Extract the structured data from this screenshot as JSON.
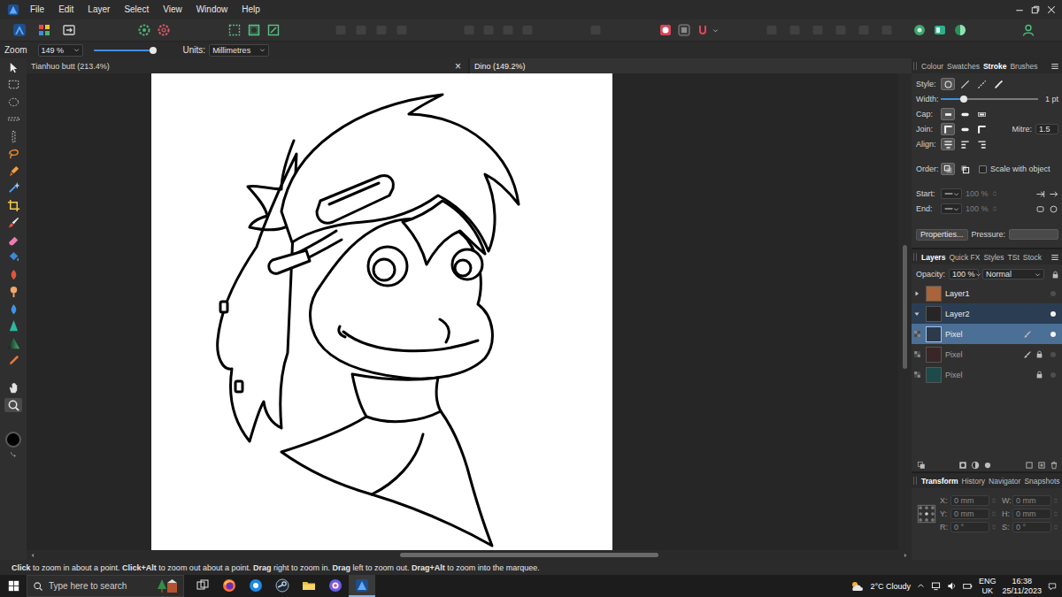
{
  "menu": [
    "File",
    "Edit",
    "Layer",
    "Select",
    "View",
    "Window",
    "Help"
  ],
  "toolbar": [
    [
      {
        "kind": "persona-photo",
        "disabled": false
      },
      {
        "kind": "persona-liquify",
        "disabled": false
      },
      {
        "kind": "persona-export",
        "disabled": false
      }
    ],
    [
      {
        "kind": "settings",
        "disabled": false
      },
      {
        "kind": "settings-alt",
        "disabled": false
      }
    ],
    [
      {
        "kind": "selection-all",
        "disabled": false
      },
      {
        "kind": "selection-invert",
        "disabled": false
      },
      {
        "kind": "selection-refine",
        "disabled": false
      }
    ],
    [
      {
        "kind": "generic",
        "disabled": true
      },
      {
        "kind": "generic",
        "disabled": true
      },
      {
        "kind": "generic",
        "disabled": true
      },
      {
        "kind": "generic",
        "disabled": true
      }
    ],
    [
      {
        "kind": "generic",
        "disabled": true
      },
      {
        "kind": "generic",
        "disabled": true
      },
      {
        "kind": "generic",
        "disabled": true
      },
      {
        "kind": "generic",
        "disabled": true
      }
    ],
    [
      {
        "kind": "generic",
        "disabled": true
      }
    ],
    [
      {
        "kind": "mask",
        "disabled": false
      },
      {
        "kind": "quick-mask",
        "disabled": false
      },
      {
        "kind": "snapping",
        "disabled": false
      }
    ],
    [
      {
        "kind": "generic",
        "disabled": true
      },
      {
        "kind": "generic",
        "disabled": true
      },
      {
        "kind": "generic",
        "disabled": true
      },
      {
        "kind": "generic",
        "disabled": true
      },
      {
        "kind": "generic",
        "disabled": true
      },
      {
        "kind": "generic",
        "disabled": true
      }
    ],
    [
      {
        "kind": "assistant",
        "disabled": false
      },
      {
        "kind": "studio",
        "disabled": false
      },
      {
        "kind": "mode",
        "disabled": false
      }
    ],
    [
      {
        "kind": "account",
        "disabled": false
      }
    ]
  ],
  "context_bar": {
    "zoom_label": "Zoom",
    "zoom_value": "149 %",
    "zoom_level": 0.97,
    "units_label": "Units:",
    "units_value": "Millimetres"
  },
  "document_tabs": [
    {
      "label": "Tianhuo butt (213.4%)",
      "selected": false,
      "show_close": true
    },
    {
      "label": "Dino (149.2%)",
      "selected": true,
      "show_close": false
    }
  ],
  "close_glyph": "×",
  "tools": [
    [
      {
        "kind": "move",
        "selected": false
      },
      {
        "kind": "rect-marquee",
        "selected": false
      },
      {
        "kind": "ellipse-marquee",
        "selected": false
      },
      {
        "kind": "row-marquee",
        "selected": false
      },
      {
        "kind": "column-marquee",
        "selected": false
      },
      {
        "kind": "freehand-selection",
        "selected": false
      },
      {
        "kind": "selection-brush",
        "selected": false
      },
      {
        "kind": "flood-select",
        "selected": false
      },
      {
        "kind": "crop",
        "selected": false
      },
      {
        "kind": "paint-brush",
        "selected": false
      },
      {
        "kind": "erase-brush",
        "selected": false
      },
      {
        "kind": "flood-fill",
        "selected": false
      },
      {
        "kind": "burn",
        "selected": false
      },
      {
        "kind": "dodge",
        "selected": false
      },
      {
        "kind": "blur",
        "selected": false
      },
      {
        "kind": "sharpen",
        "selected": false
      },
      {
        "kind": "gradient",
        "selected": false
      },
      {
        "kind": "colour-picker",
        "selected": false
      }
    ],
    [
      {
        "kind": "hand",
        "selected": false
      },
      {
        "kind": "zoom",
        "selected": true
      }
    ]
  ],
  "canvas": {
    "vscroll": {
      "start": 0.36,
      "size": 0.26
    },
    "hscroll": {
      "start": 0.42,
      "size": 0.3
    }
  },
  "stroke_panel": {
    "tabs": [
      {
        "label": "Colour",
        "selected": false
      },
      {
        "label": "Swatches",
        "selected": false
      },
      {
        "label": "Stroke",
        "selected": true
      },
      {
        "label": "Brushes",
        "selected": false
      }
    ],
    "style_label": "Style:",
    "styles": [
      {
        "kind": "none",
        "selected": true
      },
      {
        "kind": "solid",
        "selected": false
      },
      {
        "kind": "dashed",
        "selected": false
      },
      {
        "kind": "brush",
        "selected": false
      }
    ],
    "width_label": "Width:",
    "width_level": 0.24,
    "width_value": "1 pt",
    "cap_label": "Cap:",
    "caps": [
      {
        "kind": "butt",
        "selected": true
      },
      {
        "kind": "round",
        "selected": false
      },
      {
        "kind": "square",
        "selected": false
      }
    ],
    "join_label": "Join:",
    "joins": [
      {
        "kind": "miter",
        "selected": true
      },
      {
        "kind": "round",
        "selected": false
      },
      {
        "kind": "bevel",
        "selected": false
      }
    ],
    "mitre_label": "Mitre:",
    "mitre_value": "1.5",
    "align_label": "Align:",
    "aligns": [
      {
        "kind": "center",
        "selected": true
      },
      {
        "kind": "inside",
        "selected": false
      },
      {
        "kind": "outside",
        "selected": false
      }
    ],
    "order_label": "Order:",
    "orders": [
      {
        "kind": "behind",
        "selected": true
      },
      {
        "kind": "front",
        "selected": false
      }
    ],
    "scale_label": "Scale with object",
    "scale_checked": false,
    "arrowheads": [
      {
        "label": "Start:",
        "value": "100 %",
        "disabled": true
      },
      {
        "label": "End:",
        "value": "100 %",
        "disabled": true
      }
    ],
    "properties_button": "Properties...",
    "pressure_label": "Pressure:"
  },
  "layers_panel": {
    "tabs": [
      {
        "label": "Layers",
        "selected": true
      },
      {
        "label": "Quick FX",
        "selected": false
      },
      {
        "label": "Styles",
        "selected": false
      },
      {
        "label": "TSt",
        "selected": false
      },
      {
        "label": "Stock",
        "selected": false
      }
    ],
    "opacity_label": "Opacity:",
    "opacity_value": "100 %",
    "blend_mode": "Normal",
    "layers": [
      {
        "name": "Layer1",
        "kind": "layer",
        "expanded": false,
        "selected": false,
        "child_selected": false,
        "brush": false,
        "locked": false,
        "visible": false,
        "color": "#a8643a"
      },
      {
        "name": "Layer2",
        "kind": "layer",
        "expanded": true,
        "selected": false,
        "child_selected": true,
        "brush": false,
        "locked": false,
        "visible": true,
        "color": "#262626"
      },
      {
        "name": "Pixel",
        "kind": "pixel",
        "expanded": false,
        "selected": true,
        "child_selected": false,
        "brush": true,
        "locked": false,
        "visible": true,
        "color": "#2c3a4c"
      },
      {
        "name": "Pixel",
        "kind": "pixel",
        "expanded": false,
        "selected": false,
        "child_selected": false,
        "brush": true,
        "locked": true,
        "visible": false,
        "color": "#3a2626"
      },
      {
        "name": "Pixel",
        "kind": "pixel",
        "expanded": false,
        "selected": false,
        "child_selected": false,
        "brush": false,
        "locked": true,
        "visible": false,
        "color": "#1e4a4a"
      }
    ]
  },
  "transform_panel": {
    "tabs": [
      {
        "label": "Transform",
        "selected": true
      },
      {
        "label": "History",
        "selected": false
      },
      {
        "label": "Navigator",
        "selected": false
      },
      {
        "label": "Snapshots",
        "selected": false
      }
    ],
    "fields": [
      {
        "label": "X:",
        "value": "0 mm"
      },
      {
        "label": "W:",
        "value": "0 mm"
      },
      {
        "label": "Y:",
        "value": "0 mm"
      },
      {
        "label": "H:",
        "value": "0 mm"
      },
      {
        "label": "R:",
        "value": "0 °"
      },
      {
        "label": "S:",
        "value": "0 °"
      }
    ],
    "disabled": true
  },
  "status_bar": [
    {
      "text": "Click",
      "bold": true
    },
    {
      "text": " to zoom in about a point. ",
      "bold": false
    },
    {
      "text": "Click+Alt",
      "bold": true
    },
    {
      "text": " to zoom out about a point. ",
      "bold": false
    },
    {
      "text": "Drag",
      "bold": true
    },
    {
      "text": " right to zoom in. ",
      "bold": false
    },
    {
      "text": "Drag",
      "bold": true
    },
    {
      "text": " left to zoom out. ",
      "bold": false
    },
    {
      "text": "Drag+Alt",
      "bold": true
    },
    {
      "text": " to zoom into the marquee.",
      "bold": false
    }
  ],
  "taskbar": {
    "search_placeholder": "Type here to search",
    "apps": [
      {
        "kind": "task-view",
        "active": false
      },
      {
        "kind": "firefox",
        "active": false
      },
      {
        "kind": "browser",
        "active": false
      },
      {
        "kind": "steam",
        "active": false
      },
      {
        "kind": "file-explorer",
        "active": false
      },
      {
        "kind": "chat",
        "active": false
      },
      {
        "kind": "affinity-photo",
        "active": true
      }
    ],
    "weather": "2°C Cloudy",
    "language": "ENG",
    "region": "UK",
    "time": "16:38",
    "date": "25/11/2023"
  }
}
